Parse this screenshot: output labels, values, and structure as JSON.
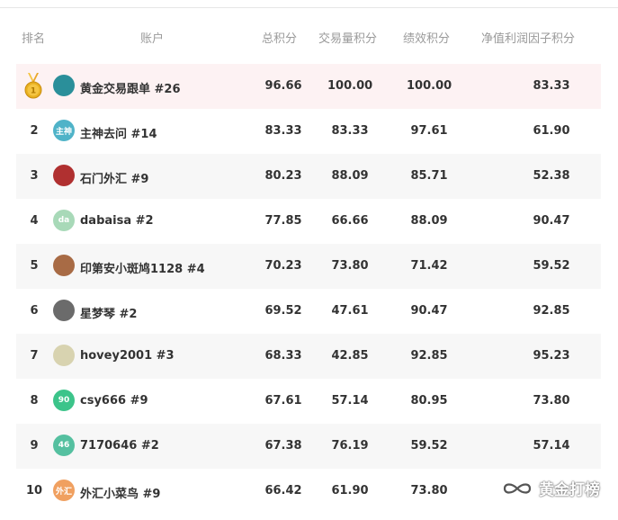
{
  "header": {
    "rank": "排名",
    "account": "账户",
    "total": "总积分",
    "volume": "交易量积分",
    "performance": "绩效积分",
    "net_value": "净值利润因子积分"
  },
  "rows": [
    {
      "rank": "1",
      "name": "黄金交易跟单 #26",
      "total": "96.66",
      "volume": "100.00",
      "performance": "100.00",
      "net": "83.33",
      "avatar_text": "",
      "avatar_color": "#2a8f9a"
    },
    {
      "rank": "2",
      "name": "主神去问 #14",
      "total": "83.33",
      "volume": "83.33",
      "performance": "97.61",
      "net": "61.90",
      "avatar_text": "主神",
      "avatar_color": "#4fb3c8"
    },
    {
      "rank": "3",
      "name": "石门外汇 #9",
      "total": "80.23",
      "volume": "88.09",
      "performance": "85.71",
      "net": "52.38",
      "avatar_text": "",
      "avatar_color": "#b03030"
    },
    {
      "rank": "4",
      "name": "dabaisa #2",
      "total": "77.85",
      "volume": "66.66",
      "performance": "88.09",
      "net": "90.47",
      "avatar_text": "da",
      "avatar_color": "#a8d9b8"
    },
    {
      "rank": "5",
      "name": "印第安小斑鸠1128 #4",
      "total": "70.23",
      "volume": "73.80",
      "performance": "71.42",
      "net": "59.52",
      "avatar_text": "",
      "avatar_color": "#a86b45"
    },
    {
      "rank": "6",
      "name": "星梦琴 #2",
      "total": "69.52",
      "volume": "47.61",
      "performance": "90.47",
      "net": "92.85",
      "avatar_text": "",
      "avatar_color": "#6b6b6b"
    },
    {
      "rank": "7",
      "name": "hovey2001 #3",
      "total": "68.33",
      "volume": "42.85",
      "performance": "92.85",
      "net": "95.23",
      "avatar_text": "",
      "avatar_color": "#d8d3b0"
    },
    {
      "rank": "8",
      "name": "csy666 #9",
      "total": "67.61",
      "volume": "57.14",
      "performance": "80.95",
      "net": "73.80",
      "avatar_text": "90",
      "avatar_color": "#3cc48a"
    },
    {
      "rank": "9",
      "name": "7170646 #2",
      "total": "67.38",
      "volume": "76.19",
      "performance": "59.52",
      "net": "57.14",
      "avatar_text": "46",
      "avatar_color": "#55c0a0"
    },
    {
      "rank": "10",
      "name": "外汇小菜鸟 #9",
      "total": "66.42",
      "volume": "61.90",
      "performance": "73.80",
      "net": "",
      "avatar_text": "外汇",
      "avatar_color": "#f0a060"
    }
  ],
  "medal": {
    "label": "1",
    "color": "#e8b020"
  },
  "watermark": {
    "text": "黄金打榜",
    "icon": "wechat-channel-icon"
  }
}
